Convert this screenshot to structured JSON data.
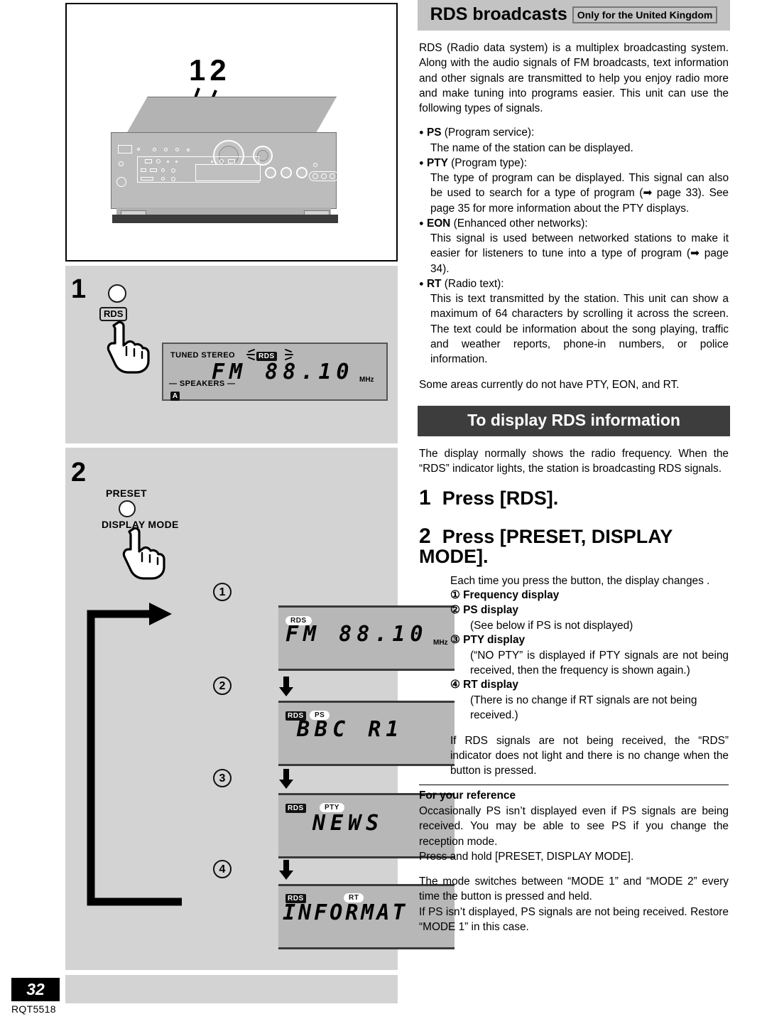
{
  "page": {
    "number": "32",
    "code": "RQT5518"
  },
  "illustration": {
    "callout": "12",
    "alt_name": "av-receiver-front-panel"
  },
  "steps": [
    {
      "number": "1",
      "button": {
        "label": "RDS",
        "type": "tagged"
      },
      "display": {
        "indicators_left": "TUNED STEREO",
        "rds_indicator": "RDS",
        "main_text": "FM  88.10",
        "unit": "MHz",
        "speakers_label": "SPEAKERS",
        "speaker_letter": "A"
      }
    },
    {
      "number": "2",
      "button": {
        "label_top": "PRESET",
        "label_bottom": "DISPLAY MODE"
      }
    }
  ],
  "sequence": [
    {
      "num": "1",
      "indicators": [
        "RDS"
      ],
      "text": "FM  88.10",
      "unit": "MHz"
    },
    {
      "num": "2",
      "indicators": [
        "RDS",
        "PS"
      ],
      "text": "BBC  R1",
      "unit": ""
    },
    {
      "num": "3",
      "indicators": [
        "RDS",
        "PTY"
      ],
      "text": "NEWS",
      "unit": ""
    },
    {
      "num": "4",
      "indicators": [
        "RDS",
        "RT"
      ],
      "text": "INFORMAT",
      "unit": ""
    }
  ],
  "right": {
    "header": {
      "title": "RDS broadcasts",
      "chip": "Only for the United Kingdom"
    },
    "intro": "RDS (Radio data system) is a multiplex broadcasting system. Along with the audio signals of FM broadcasts, text information and other signals are transmitted to help you enjoy radio more and make tuning into programs easier. This unit can use the following types of signals.",
    "bullets": [
      {
        "term": "PS",
        "paren": "(Program service):",
        "desc": "The name of the station can be displayed."
      },
      {
        "term": "PTY",
        "paren": "(Program type):",
        "desc": "The type of program can be displayed. This signal can also be used to search for a type of program (➡ page 33). See page 35 for more information about the PTY displays."
      },
      {
        "term": "EON",
        "paren": "(Enhanced other networks):",
        "desc": "This signal is used between networked stations to make it easier for listeners to tune into a type of program (➡ page 34)."
      },
      {
        "term": "RT",
        "paren": "(Radio text):",
        "desc": "This is text transmitted by the station. This unit can show a maximum of 64 characters by scrolling it across the screen. The text could be information about the song playing, traffic and weather reports, phone-in numbers, or police information."
      }
    ],
    "note_some_areas": "Some areas currently do not have PTY, EON, and RT.",
    "section_header": "To display RDS information",
    "section_intro": "The display normally shows the radio frequency. When the “RDS” indicator lights, the station is broadcasting RDS signals.",
    "step1": {
      "num": "1",
      "text": "Press [RDS]."
    },
    "step2": {
      "num": "2",
      "text": "Press [PRESET, DISPLAY MODE]."
    },
    "step2_lead": "Each time you press the button, the display changes .",
    "step2_items": [
      {
        "mark": "①",
        "label": "Frequency display",
        "sub": ""
      },
      {
        "mark": "②",
        "label": "PS display",
        "sub": "(See below if PS is not displayed)"
      },
      {
        "mark": "③",
        "label": "PTY display",
        "sub": "(“NO PTY” is displayed if PTY signals are not being received, then the frequency is shown again.)"
      },
      {
        "mark": "④",
        "label": "RT display",
        "sub": "(There is no change if RT signals are not being received.)"
      }
    ],
    "step2_note": "If RDS signals are not being received, the “RDS” indicator does not light and there is no change when the button is pressed.",
    "reference_title": "For your reference",
    "reference_paras": [
      "Occasionally PS isn’t displayed even if PS signals are being received. You may be able to see PS if you change the reception mode.",
      "Press and hold [PRESET, DISPLAY MODE].",
      "The mode switches between “MODE 1” and “MODE 2” every time the button is pressed and held.",
      "If PS isn’t displayed, PS signals are not being received. Restore “MODE 1” in this case."
    ]
  },
  "colors": {
    "panel_gray": "#d3d3d3",
    "lcd_gray": "#b7b7b7",
    "header_gray": "#c3c3c3",
    "header_dark": "#3d3d3d"
  }
}
